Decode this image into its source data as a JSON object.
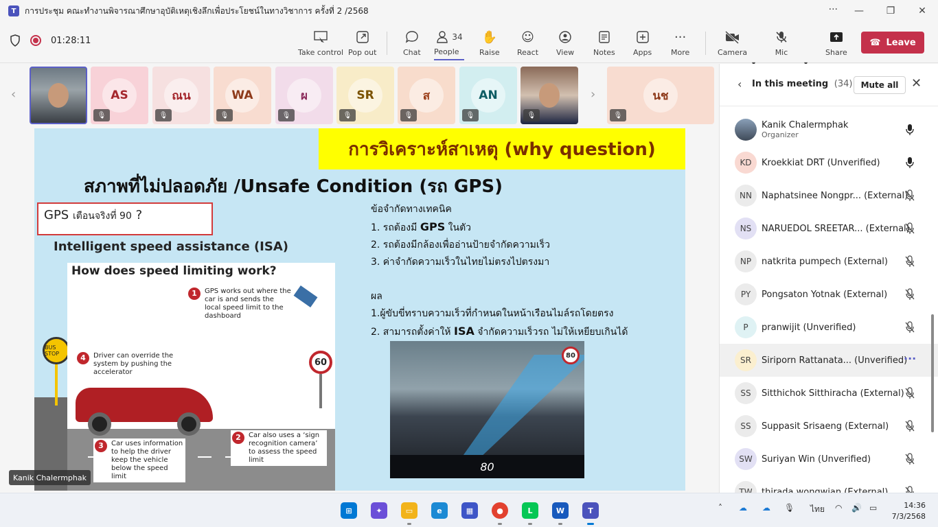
{
  "window": {
    "title": "การประชุม คณะทำงานพิจารณาศึกษาอุบัติเหตุเชิงลึกเพื่อประโยชน์ในทางวิชาการ ครั้งที่ 2 /2568",
    "more": "···",
    "minimize": "—",
    "maximize": "❐",
    "close": "✕"
  },
  "toolbar": {
    "timer": "01:28:11",
    "buttons": {
      "take_control": "Take control",
      "pop_out": "Pop out",
      "chat": "Chat",
      "people": "People",
      "people_count": "34",
      "raise": "Raise",
      "react": "React",
      "view": "View",
      "notes": "Notes",
      "apps": "Apps",
      "more": "More",
      "camera": "Camera",
      "mic": "Mic",
      "share": "Share",
      "leave": "Leave"
    }
  },
  "participants_strip": [
    {
      "initials": "",
      "color": "#ffffff"
    },
    {
      "initials": "AS",
      "color": "#f8d2d8",
      "text": "#a4262c"
    },
    {
      "initials": "ณน",
      "color": "#f6e0e0",
      "text": "#a4262c"
    },
    {
      "initials": "WA",
      "color": "#f8dcd0",
      "text": "#8e3a1a"
    },
    {
      "initials": "ผ",
      "color": "#f2dcea",
      "text": "#8b2a5a"
    },
    {
      "initials": "SR",
      "color": "#f8ecc8",
      "text": "#7a5200"
    },
    {
      "initials": "ส",
      "color": "#f8dccc",
      "text": "#9a3d17"
    },
    {
      "initials": "AN",
      "color": "#d2eef0",
      "text": "#0d5c63"
    },
    {
      "initials": "",
      "color": "#ffffff"
    },
    {
      "initials": "นช",
      "color": "#f8dcd0",
      "text": "#8e3a1a"
    }
  ],
  "slide": {
    "banner": "การวิเคราะห์สาเหตุ (why question)",
    "title": "สภาพที่ไม่ปลอดภัย /Unsafe Condition (รถ GPS)",
    "gps_box_main": "GPS",
    "gps_box_small": "เตือนจริงที่ 90",
    "gps_box_q": "?",
    "isa_heading": "Intelligent speed assistance (ISA)",
    "info_title": "How does speed limiting work?",
    "steps": [
      {
        "n": "1",
        "text": "GPS works out where the car is and sends the local speed limit to the dashboard"
      },
      {
        "n": "2",
        "text": "Car also uses a ‘sign recognition camera’ to assess the speed limit"
      },
      {
        "n": "3",
        "text": "Car uses information to help the driver keep the vehicle below the speed limit"
      },
      {
        "n": "4",
        "text": "Driver can override the system by pushing the accelerator"
      }
    ],
    "sign_value": "60",
    "bus_stop": "BUS STOP",
    "limits_heading": "ข้อจำกัดทางเทคนิค",
    "limit_1_pre": "1. รถต้องมี",
    "limit_1_big": "GPS",
    "limit_1_post": "ในตัว",
    "limit_2": "2. รถต้องมีกล้องเพื่ออ่านป้ายจำกัดความเร็ว",
    "limit_3": "3. ค่าจำกัดความเร็วในไทยไม่ตรงไปตรงมา",
    "result_heading": "ผล",
    "result_1": "1.ผู้ขับขี่ทราบความเร็วที่กำหนดในหน้าเรือนไมล์รถโดยตรง",
    "result_2_pre": "2. สามารถตั้งค่าให้",
    "result_2_big": "ISA",
    "result_2_post": "จำกัดความเร็วรถ ไม่ให้เหยียบเกินได้",
    "hud_sign": "80",
    "hud_speed": "80"
  },
  "speaker_label": "Kanik Chalermphak",
  "panel": {
    "title": "In this meeting",
    "count": "(34)",
    "mute_all": "Mute all",
    "people": [
      {
        "name": "Kanik Chalermphak",
        "role": "Organizer",
        "initials": "",
        "avatar_color": "",
        "mic": "on"
      },
      {
        "name": "Kroekkiat DRT (Unverified)",
        "initials": "KD",
        "avatar_color": "#f9d9d2",
        "mic": "on"
      },
      {
        "name": "Naphatsinee Nongpr... (External)",
        "initials": "NN",
        "avatar_color": "#ebebeb",
        "mic": "off"
      },
      {
        "name": "NARUEDOL SREETAR... (External)",
        "initials": "NS",
        "avatar_color": "#e2e0f4",
        "mic": "off"
      },
      {
        "name": "natkrita pumpech (External)",
        "initials": "NP",
        "avatar_color": "#ebebeb",
        "mic": "off"
      },
      {
        "name": "Pongsaton Yotnak (External)",
        "initials": "PY",
        "avatar_color": "#ebebeb",
        "mic": "off"
      },
      {
        "name": "pranwijit (Unverified)",
        "initials": "P",
        "avatar_color": "#dff2f4",
        "mic": "off"
      },
      {
        "name": "Siriporn Rattanata...  (Unverified)",
        "initials": "SR",
        "avatar_color": "#fbefcf",
        "mic": "more"
      },
      {
        "name": "Sitthichok Sitthiracha (External)",
        "initials": "SS",
        "avatar_color": "#ebebeb",
        "mic": "off"
      },
      {
        "name": "Suppasit Srisaeng (External)",
        "initials": "SS",
        "avatar_color": "#ebebeb",
        "mic": "off"
      },
      {
        "name": "Suriyan Win (Unverified)",
        "initials": "SW",
        "avatar_color": "#e2e0f4",
        "mic": "off"
      },
      {
        "name": "thirada wongwian (External)",
        "initials": "TW",
        "avatar_color": "#ebebeb",
        "mic": "off"
      }
    ]
  },
  "taskbar": {
    "lang": "ไทย",
    "time": "14:36",
    "date": "7/3/2568"
  }
}
